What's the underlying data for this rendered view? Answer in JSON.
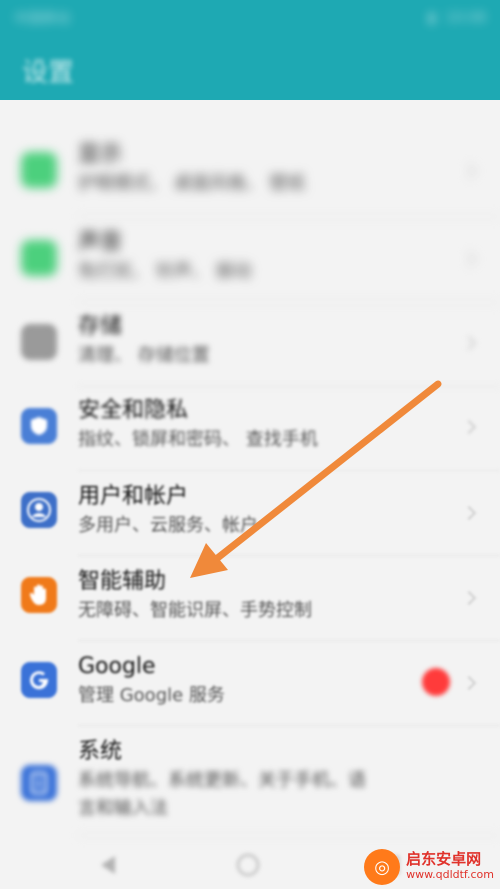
{
  "app": {
    "title": "设置"
  },
  "status": {
    "left": "中国移动",
    "right": "10:08"
  },
  "items": [
    {
      "key": "display",
      "label": "显示",
      "sub": "护眼模式、 桌面风格、 壁纸",
      "icon": "display-icon",
      "color": "#4cd07d"
    },
    {
      "key": "sound",
      "label": "声音",
      "sub": "免打扰、 铃声、 振动",
      "icon": "sound-icon",
      "color": "#4cd07d"
    },
    {
      "key": "storage",
      "label": "存储",
      "sub": "清理、 存储位置",
      "icon": "storage-icon",
      "color": "#9a9a9a"
    },
    {
      "key": "security",
      "label": "安全和隐私",
      "sub": "指纹、锁屏和密码、 查找手机",
      "icon": "shield-icon",
      "color": "#4a7fd6"
    },
    {
      "key": "accounts",
      "label": "用户和帐户",
      "sub": "多用户、云服务、帐户",
      "icon": "user-icon",
      "color": "#3d6fc8"
    },
    {
      "key": "assist",
      "label": "智能辅助",
      "sub": "无障碍、智能识屏、手势控制",
      "icon": "hand-icon",
      "color": "#f07a1a"
    },
    {
      "key": "google",
      "label": "Google",
      "sub": "管理 Google 服务",
      "icon": "google-icon",
      "color": "#3a72d8"
    },
    {
      "key": "system",
      "label": "系统",
      "sub": "系统导航、系统更新、关于手机、语言和输入法",
      "sub1": "系统导航、系统更新、关于手机、语",
      "sub2": "言和输入法",
      "icon": "info-icon",
      "color": "#3a72d8"
    }
  ],
  "watermark": {
    "name": "启东安卓网",
    "url": "www.qdldtf.com",
    "logo_glyph": "◎"
  },
  "colors": {
    "header": "#1ea9b3",
    "arrow": "#f0893a",
    "badge": "#ff3b3b"
  }
}
